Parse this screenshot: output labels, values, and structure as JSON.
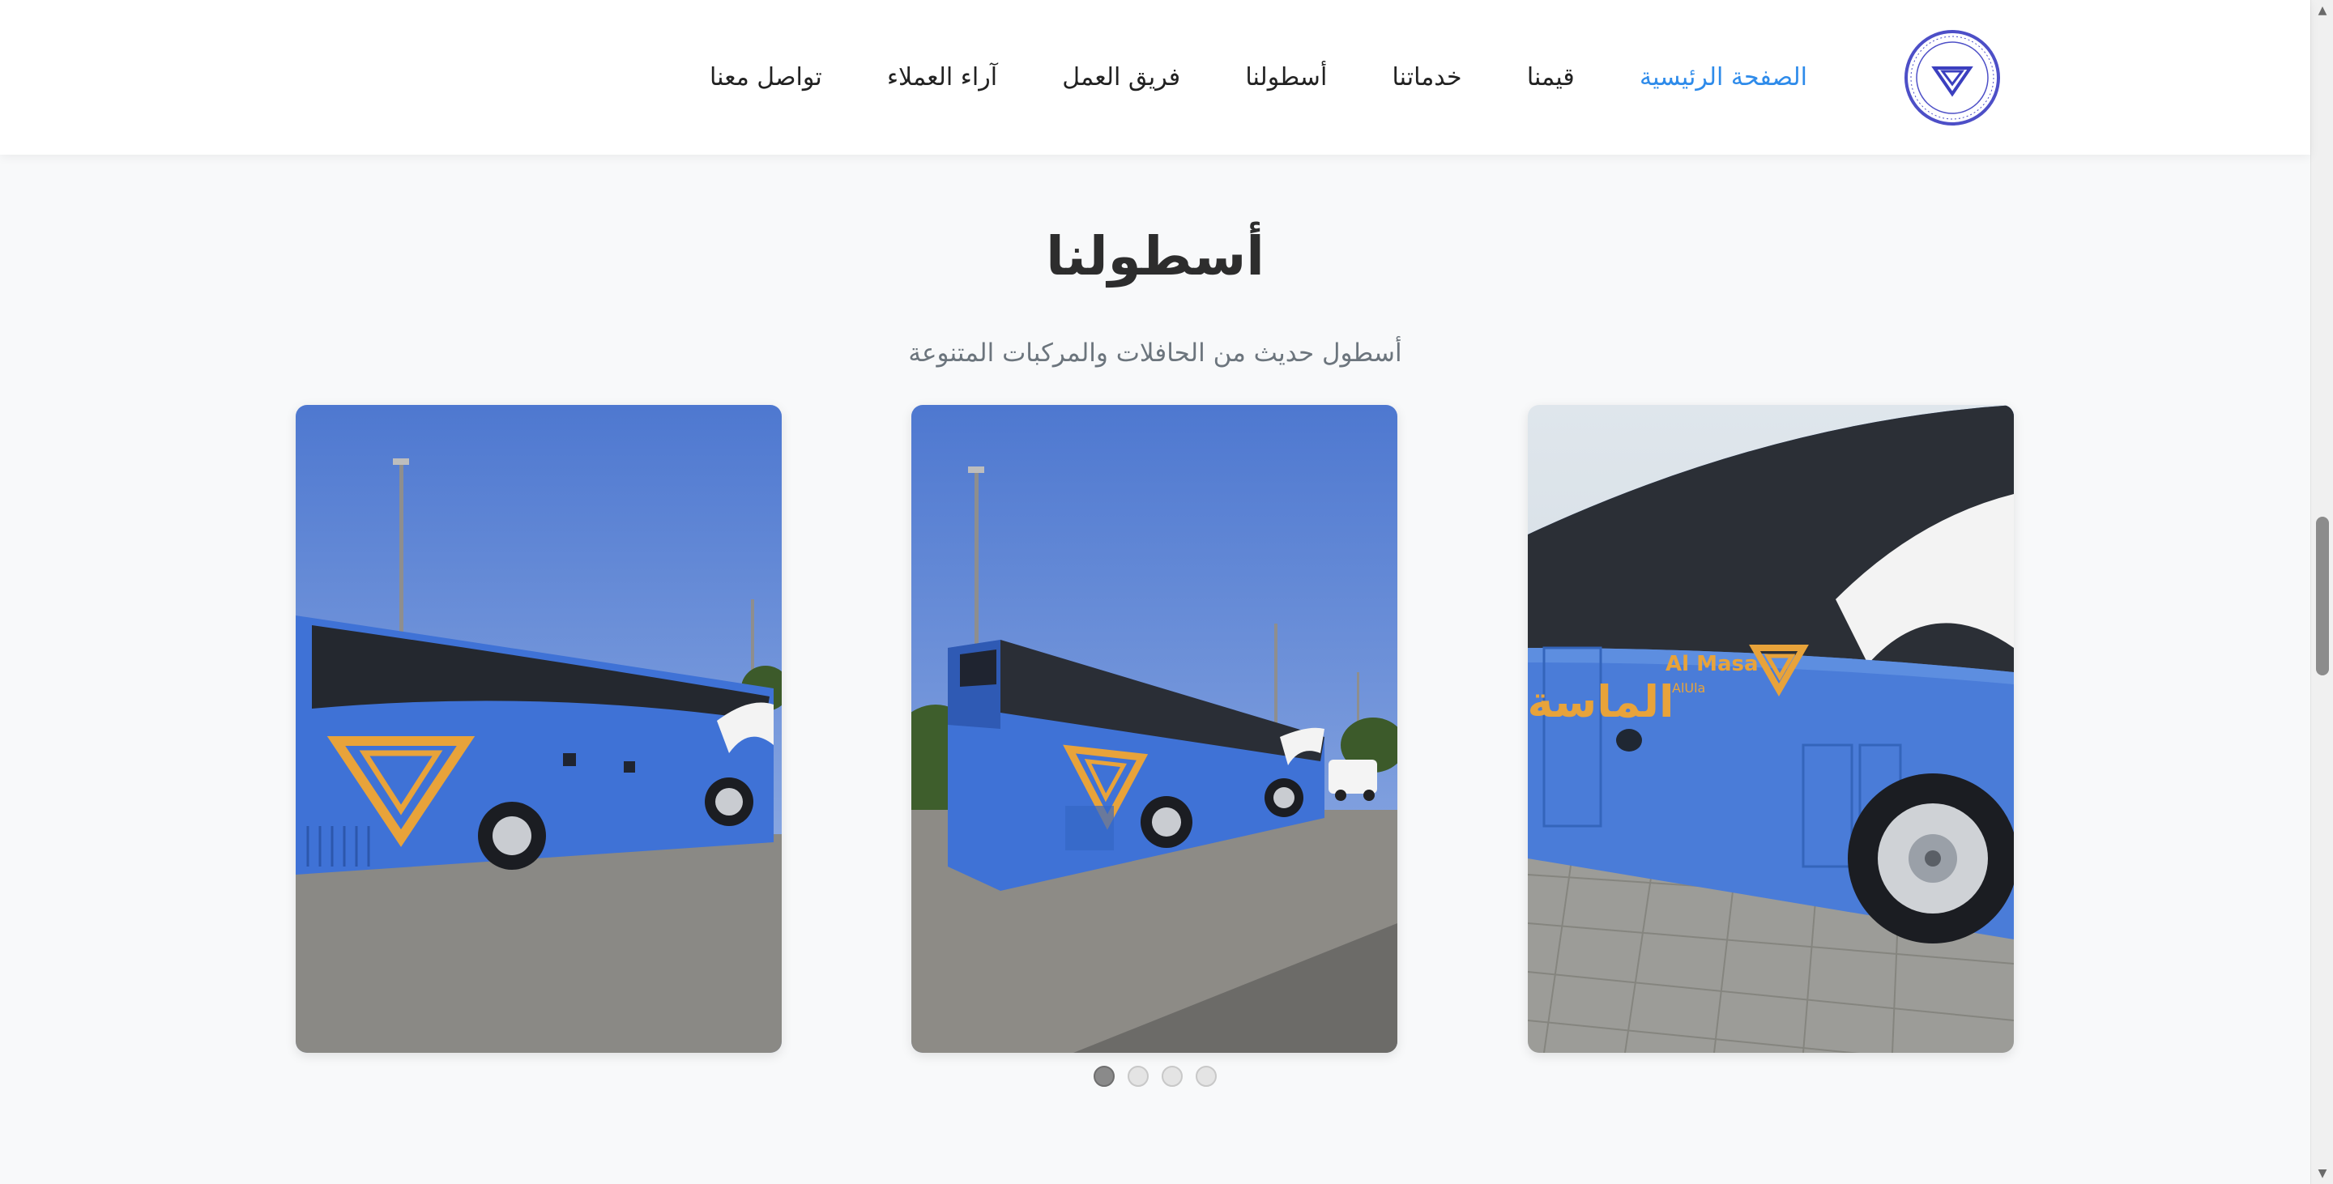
{
  "header": {
    "logo_icon": "company-diamond-seal-logo",
    "nav": [
      {
        "label": "الصفحة الرئيسية",
        "active": true
      },
      {
        "label": "قيمنا",
        "active": false
      },
      {
        "label": "خدماتنا",
        "active": false
      },
      {
        "label": "أسطولنا",
        "active": false
      },
      {
        "label": "فريق العمل",
        "active": false
      },
      {
        "label": "آراء العملاء",
        "active": false
      },
      {
        "label": "تواصل معنا",
        "active": false
      }
    ],
    "active_color": "#2e8bea"
  },
  "section": {
    "title": "أسطولنا",
    "subtitle": "أسطول حديث من الحافلات والمركبات المتنوعة"
  },
  "gallery": {
    "bus_livery": {
      "en_name": "Al Masa",
      "en_sub": "AlUla",
      "ar_name": "الماسة"
    },
    "colors": {
      "bus_blue": "#3f72d6",
      "logo_gold": "#e8a33a",
      "sky": "#6f93da"
    },
    "photos": [
      "bus-side-closeup-photo",
      "bus-rear-three-quarter-photo",
      "bus-side-full-photo"
    ]
  },
  "carousel": {
    "total": 4,
    "active_index": 0
  }
}
